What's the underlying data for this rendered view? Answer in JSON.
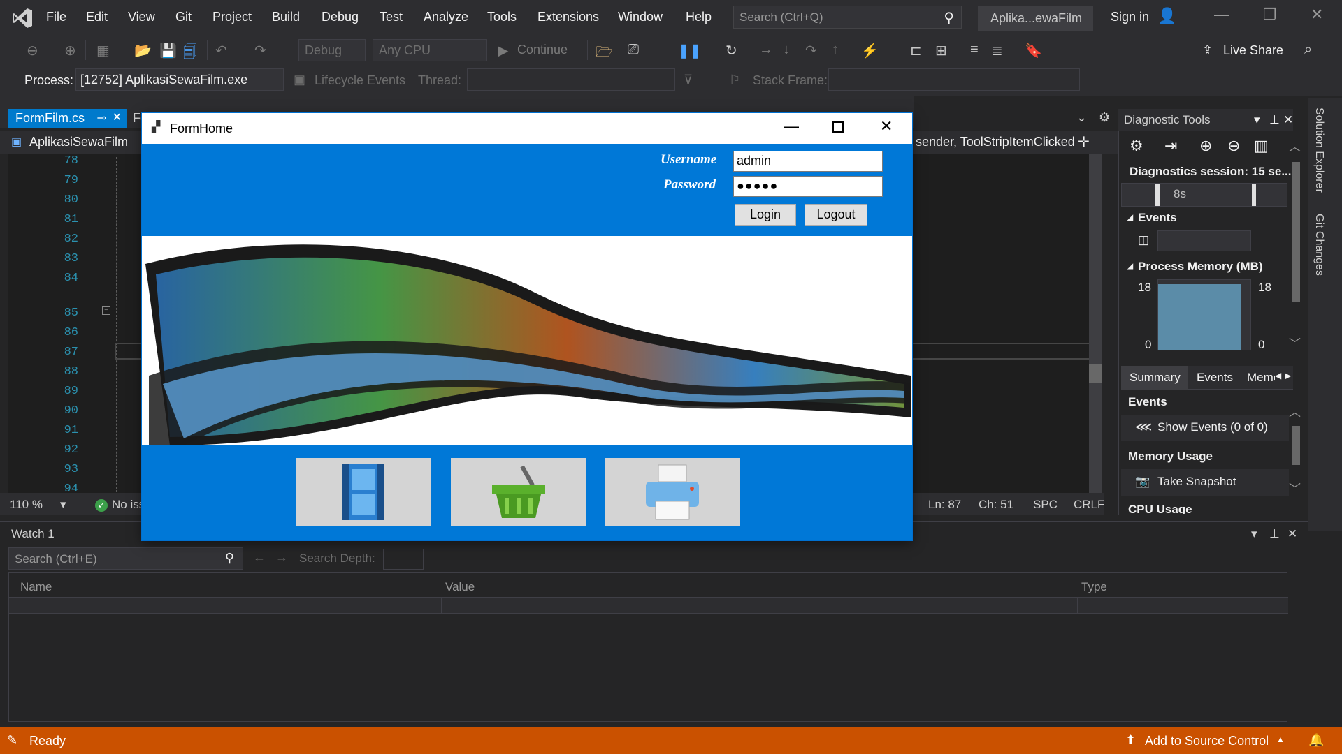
{
  "menu": [
    "File",
    "Edit",
    "View",
    "Git",
    "Project",
    "Build",
    "Debug",
    "Test",
    "Analyze",
    "Tools",
    "Extensions",
    "Window",
    "Help"
  ],
  "search_placeholder": "Search (Ctrl+Q)",
  "solution_name": "Aplika...ewaFilm",
  "sign_in": "Sign in",
  "live_share": "Live Share",
  "toolbar": {
    "config": "Debug",
    "platform": "Any CPU",
    "continue": "Continue"
  },
  "debugbar": {
    "process_label": "Process:",
    "process_value": "[12752] AplikasiSewaFilm.exe",
    "lifecycle": "Lifecycle Events",
    "thread_label": "Thread:",
    "stack_label": "Stack Frame:"
  },
  "editor": {
    "tab_active": "FormFilm.cs",
    "tab_next": "Fo",
    "project": "AplikasiSewaFilm",
    "member": "sender, ToolStripItemClicked",
    "line_numbers": [
      "78",
      "79",
      "80",
      "81",
      "82",
      "83",
      "84",
      "85",
      "86",
      "87",
      "88",
      "89",
      "90",
      "91",
      "92",
      "93",
      "94"
    ],
    "zoom": "110 %",
    "issues": "No iss",
    "ln": "Ln: 87",
    "ch": "Ch: 51",
    "spc": "SPC",
    "crlf": "CRLF"
  },
  "diagnostics": {
    "title": "Diagnostic Tools",
    "session": "Diagnostics session: 15 se...",
    "timeline_label": "8s",
    "events_section": "Events",
    "memory_section": "Process Memory (MB)",
    "mem_max_left": "18",
    "mem_max_right": "18",
    "mem_min_left": "0",
    "mem_min_right": "0",
    "tabs": [
      "Summary",
      "Events",
      "Memo"
    ],
    "events_heading": "Events",
    "show_events": "Show Events (0 of 0)",
    "memory_heading": "Memory Usage",
    "take_snapshot": "Take Snapshot",
    "cpu_heading": "CPU Usage"
  },
  "side_tabs": [
    "Solution Explorer",
    "Git Changes"
  ],
  "watch": {
    "title": "Watch 1",
    "search_placeholder": "Search (Ctrl+E)",
    "search_depth": "Search Depth:",
    "columns": [
      "Name",
      "Value",
      "Type"
    ]
  },
  "status": {
    "ready": "Ready",
    "source_control": "Add to Source Control"
  },
  "formhome": {
    "title": "FormHome",
    "username_label": "Username",
    "password_label": "Password",
    "username_value": "admin",
    "password_value": "●●●●●",
    "login": "Login",
    "logout": "Logout"
  }
}
